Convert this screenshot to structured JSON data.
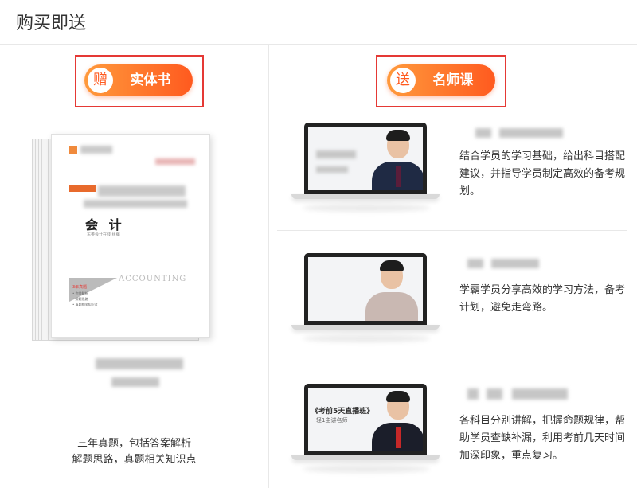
{
  "header": {
    "title": "购买即送"
  },
  "left": {
    "badge": {
      "icon_char": "赠",
      "label": "实体书"
    },
    "book": {
      "title": "会 计",
      "subtitle": "东奥会计在线  组编",
      "watermark": "ACCOUNTING",
      "tag": "3年真题",
      "bullets": [
        "• 完美解析",
        "• 解题思路",
        "• 真题相关知识点"
      ]
    },
    "description": [
      "三年真题，包括答案解析",
      "解题思路，真题相关知识点"
    ]
  },
  "right": {
    "badge": {
      "icon_char": "送",
      "label": "名师课"
    },
    "rows": [
      {
        "description": "结合学员的学习基础，给出科目搭配建议，并指导学员制定高效的备考规划。"
      },
      {
        "description": "学霸学员分享高效的学习方法，备考计划，避免走弯路。"
      },
      {
        "description": "各科目分别讲解，把握命题规律，帮助学员查缺补漏，利用考前几天时间加深印象，重点复习。",
        "screen_title": "《考前5天直播班》",
        "screen_subtitle": "轻1主讲名师"
      }
    ]
  },
  "colors": {
    "accent_start": "#ff9a3c",
    "accent_end": "#ff5a1f",
    "highlight_frame": "#e53935"
  }
}
